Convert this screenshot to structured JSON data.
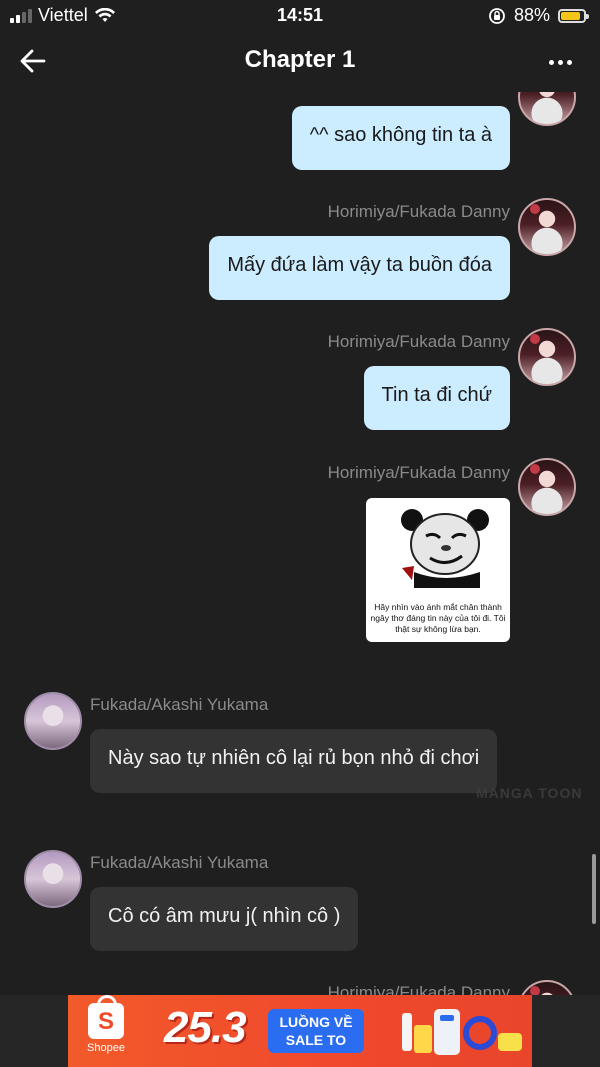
{
  "status_bar": {
    "carrier": "Viettel",
    "time": "14:51",
    "battery_percent": "88%",
    "battery_level": 0.88,
    "icons": [
      "signal-icon",
      "wifi-icon",
      "orientation-lock-icon",
      "battery-icon"
    ]
  },
  "header": {
    "title": "Chapter 1",
    "back_icon": "arrow-left-icon",
    "more_icon": "more-dots-icon"
  },
  "messages": [
    {
      "side": "right",
      "name": "",
      "text": "^^ sao không tin ta à",
      "avatar": "girl"
    },
    {
      "side": "right",
      "name": "Horimiya/Fukada Danny",
      "text": "Mấy đứa làm vậy ta buồn đóa",
      "avatar": "girl"
    },
    {
      "side": "right",
      "name": "Horimiya/Fukada Danny",
      "text": "Tin ta đi chứ",
      "avatar": "girl"
    },
    {
      "side": "right",
      "name": "Horimiya/Fukada Danny",
      "sticker_caption": "Hãy nhìn vào ánh mắt chân thành ngây thơ đáng tin này của tôi đi. Tôi thật sự không lừa bạn.",
      "avatar": "girl"
    },
    {
      "side": "left",
      "name": "Fukada/Akashi Yukama",
      "text": "Này sao tự nhiên cô lại rủ bọn nhỏ đi chơi",
      "avatar": "boy"
    },
    {
      "side": "left",
      "name": "Fukada/Akashi Yukama",
      "text": "Cô có âm mưu j( nhìn cô )",
      "avatar": "boy"
    },
    {
      "side": "right",
      "name": "Horimiya/Fukada Danny",
      "text": "",
      "avatar": "girl"
    }
  ],
  "watermark": "MANGA TOON",
  "ad": {
    "brand": "Shopee",
    "date": "25.3",
    "headline_line1": "LUỒNG VỀ",
    "headline_line2": "SALE TO",
    "colors": {
      "primary": "#f04a2c",
      "accent": "#2b6df0"
    }
  },
  "colors": {
    "background": "#1f1f1f",
    "outgoing_bubble": "#ccecff",
    "incoming_bubble": "#333333",
    "name_text": "#8a8a8a",
    "battery": "#f5c518"
  }
}
